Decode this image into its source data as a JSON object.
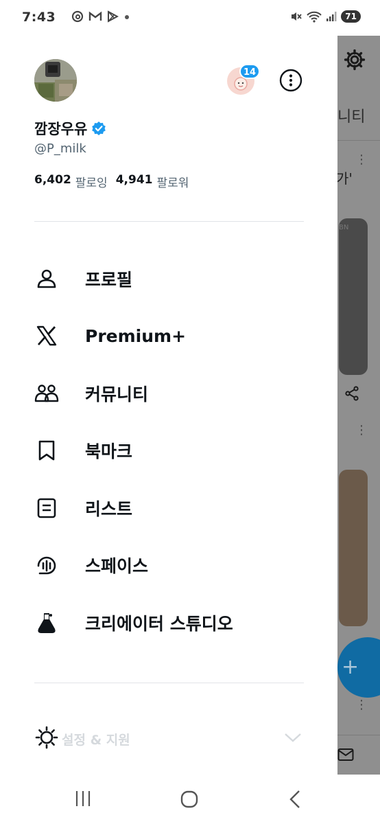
{
  "status_bar": {
    "time": "7:43",
    "left_icons": [
      "threads-icon",
      "gmail-icon",
      "play-store-icon",
      "dot-icon"
    ],
    "right_icons": [
      "mute-icon",
      "wifi-icon",
      "signal-icon"
    ],
    "battery": "71"
  },
  "profile": {
    "display_name": "깜장우유",
    "verified": true,
    "handle": "@P_milk",
    "following_count": "6,402",
    "following_label": "팔로잉",
    "followers_count": "4,941",
    "followers_label": "팔로워",
    "notification_badge": "14"
  },
  "menu": [
    {
      "label": "프로필",
      "icon": "person-icon"
    },
    {
      "label": "Premium+",
      "icon": "x-logo-icon"
    },
    {
      "label": "커뮤니티",
      "icon": "communities-icon"
    },
    {
      "label": "북마크",
      "icon": "bookmark-icon"
    },
    {
      "label": "리스트",
      "icon": "list-icon"
    },
    {
      "label": "스페이스",
      "icon": "spaces-icon"
    },
    {
      "label": "크리에이터 스튜디오",
      "icon": "creator-studio-icon"
    }
  ],
  "settings": {
    "label": "설정 & 지원",
    "icon": "sun-icon"
  },
  "background": {
    "tab_text": "니티",
    "quote_text": "가'"
  },
  "colors": {
    "accent": "#1d9bf0",
    "text": "#0f1419",
    "secondary_text": "#536471"
  }
}
